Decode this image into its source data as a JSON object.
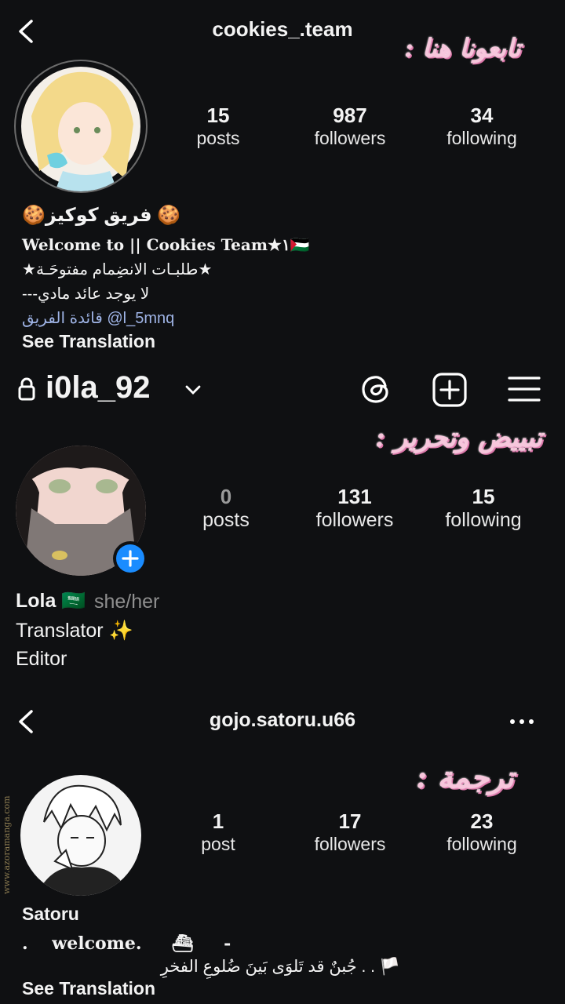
{
  "sections": [
    {
      "username": "cookies_.team",
      "stats": [
        {
          "num": "15",
          "label": "posts"
        },
        {
          "num": "987",
          "label": "followers"
        },
        {
          "num": "34",
          "label": "following"
        }
      ],
      "display_name": "🍪فريق كوكيز 🍪",
      "bio_lines": [
        "Welcome to || Cookies Team★١🇵🇸",
        "★طلبـات الانضِمام مفتوحَـة★",
        "---لا يوجد عائد مادي",
        "قائدة الفريق @l_5mnq"
      ],
      "see_translation": "See Translation"
    },
    {
      "username": "i0la_92",
      "stats": [
        {
          "num": "0",
          "label": "posts"
        },
        {
          "num": "131",
          "label": "followers"
        },
        {
          "num": "15",
          "label": "following"
        }
      ],
      "display_name": "Lola 🇸🇦",
      "pronouns": "she/her",
      "bio_lines": [
        "Translator ✨",
        "Editor"
      ]
    },
    {
      "username": "gojo.satoru.u66",
      "stats": [
        {
          "num": "1",
          "label": "post"
        },
        {
          "num": "17",
          "label": "followers"
        },
        {
          "num": "23",
          "label": "following"
        }
      ],
      "display_name": "Satoru",
      "bio_lines": [
        ".    welcome.     ⛴     -",
        "🏳️ . . جُبنٌ قد تَلوَى بَينَ ضُلوعِ الفخرِ"
      ],
      "see_translation": "See Translation"
    }
  ],
  "overlays": {
    "follow_us": "تابعونا هنا :",
    "cleaning_editing": "تبييض وتحرير :",
    "translation": "ترجمة :"
  },
  "watermark": "www.azoramanga.com",
  "icons": [
    "back-arrow-icon",
    "lock-icon",
    "chevron-down-icon",
    "threads-icon",
    "plus-square-icon",
    "hamburger-menu-icon",
    "more-dots-icon",
    "add-story-icon"
  ]
}
